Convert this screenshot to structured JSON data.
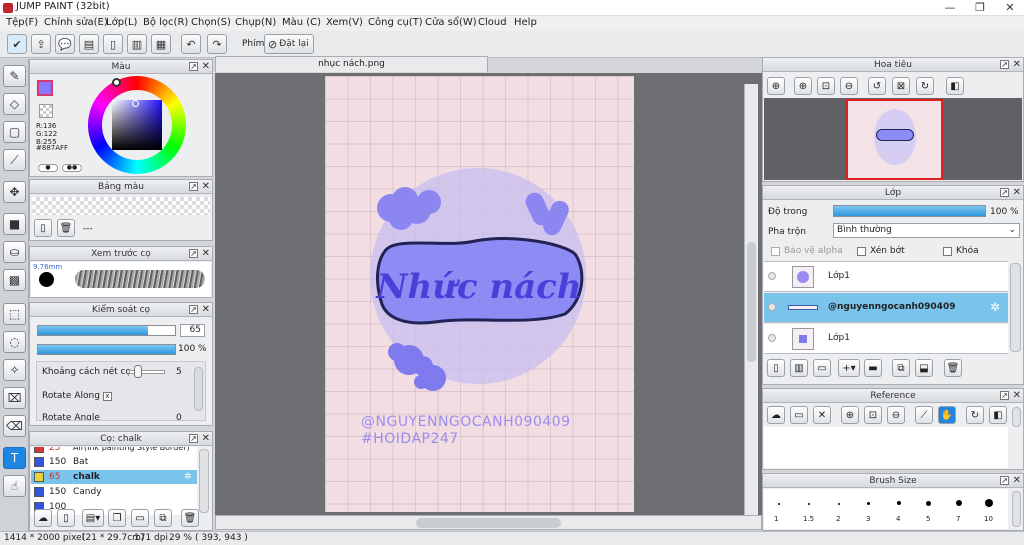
{
  "window": {
    "title": "JUMP PAINT (32bit)",
    "minimize": "—",
    "maximize": "❐",
    "close": "✕"
  },
  "menu": [
    "Tệp(F)",
    "Chỉnh sửa(E)",
    "Lớp(L)",
    "Bộ lọc(R)",
    "Chọn(S)",
    "Chụp(N)",
    "Màu (C)",
    "Xem(V)",
    "Công cụ(T)",
    "Cửa sổ(W)",
    "Cloud",
    "Help"
  ],
  "toolbar": {
    "label_phim": "Phím",
    "reset_label": "Đặt lại"
  },
  "color_panel": {
    "title": "Màu",
    "r": "R:136",
    "g": "G:122",
    "b": "B:255",
    "hex": "#887AFF"
  },
  "swatch_panel": {
    "title": "Bảng màu",
    "empty": "---"
  },
  "brush_preview": {
    "title": "Xem trước cọ",
    "size": "9.76mm"
  },
  "brush_control": {
    "title": "Kiểm soát cọ",
    "size_value": "65",
    "opacity_value": "100 %",
    "spacing_label": "Khoảng cách nét cọ",
    "spacing_value": "5",
    "rotate_along": "Rotate Along",
    "rotate_angle": "Rotate Angle",
    "rotate_angle_value": "0"
  },
  "brush_list": {
    "title": "Cọ: chalk",
    "items": [
      {
        "size": "25",
        "name": "Air(Ink painting Style Border)",
        "color": "#d63838"
      },
      {
        "size": "150",
        "name": "Bat",
        "color": "#3355dd"
      },
      {
        "size": "65",
        "name": "chalk",
        "color": "#e8d43a"
      },
      {
        "size": "150",
        "name": "Candy",
        "color": "#3355dd"
      },
      {
        "size": "100",
        "name": "",
        "color": "#3355dd"
      }
    ]
  },
  "document": {
    "tab": "nhục nách.png",
    "art_title": "Nhức nách",
    "watermark1": "@NGUYENNGOCANH090409",
    "watermark2": "#HOIDAP247"
  },
  "navigator": {
    "title": "Hoa tiêu"
  },
  "layer_panel": {
    "title": "Lớp",
    "opacity_label": "Độ trong",
    "opacity_value": "100 %",
    "blend_label": "Pha trộn",
    "blend_value": "Bình thường",
    "protect_alpha": "Bảo vệ alpha",
    "clip": "Xén bớt",
    "lock": "Khóa",
    "layers": [
      "Lớp1",
      "@nguyenngocanh090409",
      "Lớp1"
    ]
  },
  "reference_panel": {
    "title": "Reference"
  },
  "brush_size_panel": {
    "title": "Brush Size",
    "sizes": [
      "1",
      "1.5",
      "2",
      "3",
      "4",
      "5",
      "7",
      "10"
    ]
  },
  "status": {
    "pixels": "1414 * 2000 pixel",
    "cm": "(21 * 29.7cm)",
    "dpi": "171 dpi",
    "zoom": "29 %",
    "coords": "( 393, 943 )"
  },
  "colors": {
    "accent": "#2e97db",
    "primary_color": "#887AFF",
    "paper": "#f1dde2",
    "label_fill": "#8c8cf4",
    "circle": "#c8bdf0"
  }
}
